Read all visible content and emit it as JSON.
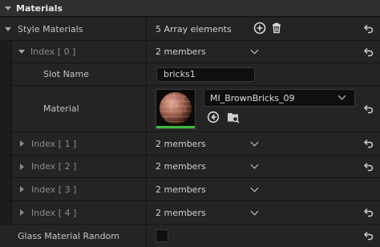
{
  "section": {
    "title": "Materials"
  },
  "style_materials": {
    "label": "Style Materials",
    "summary": "5 Array elements"
  },
  "index0": {
    "label": "Index [ 0 ]",
    "value": "2 members",
    "slot_name_label": "Slot Name",
    "slot_name_value": "bricks1",
    "material_label": "Material",
    "material_value": "MI_BrownBricks_09"
  },
  "indices": [
    {
      "label": "Index [ 1 ]",
      "value": "2 members"
    },
    {
      "label": "Index [ 2 ]",
      "value": "2 members"
    },
    {
      "label": "Index [ 3 ]",
      "value": "2 members"
    },
    {
      "label": "Index [ 4 ]",
      "value": "2 members"
    }
  ],
  "glass": {
    "label": "Glass Material Random",
    "checked": false
  },
  "colors": {
    "accent_green": "#3fb83f",
    "background": "#1a1a1a",
    "row": "#242424",
    "header": "#2f2f2f"
  },
  "icons": [
    "collapse-arrow-icon",
    "add-element-icon",
    "delete-icon",
    "reset-to-default-icon",
    "chevron-down-icon",
    "use-selected-asset-icon",
    "browse-to-asset-icon"
  ]
}
